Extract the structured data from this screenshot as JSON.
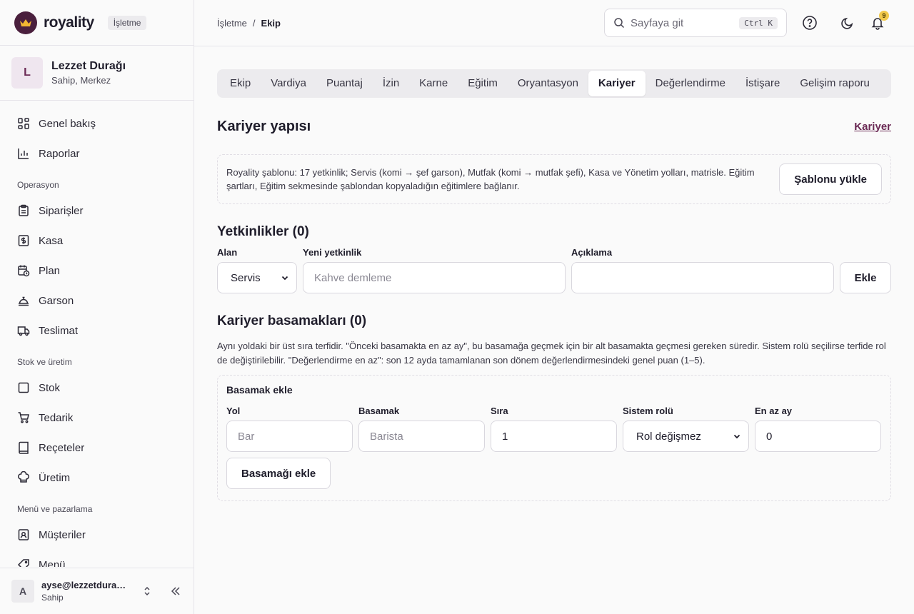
{
  "brand": {
    "name": "royality",
    "badge": "İşletme"
  },
  "org": {
    "initial": "L",
    "name": "Lezzet Durağı",
    "subtitle": "Sahip, Merkez"
  },
  "nav": {
    "overview": "Genel bakış",
    "reports": "Raporlar",
    "section_operations": "Operasyon",
    "orders": "Siparişler",
    "cashier": "Kasa",
    "plan": "Plan",
    "waiter": "Garson",
    "delivery": "Teslimat",
    "section_stock": "Stok ve üretim",
    "stock": "Stok",
    "supply": "Tedarik",
    "recipes": "Reçeteler",
    "production": "Üretim",
    "section_menu": "Menü ve pazarlama",
    "customers": "Müşteriler",
    "menu": "Menü"
  },
  "user": {
    "initial": "A",
    "email": "ayse@lezzetduragi.com",
    "role": "Sahip"
  },
  "header": {
    "crumb_parent": "İşletme",
    "crumb_sep": "/",
    "crumb_current": "Ekip",
    "search_placeholder": "Sayfaya git",
    "search_shortcut": "Ctrl K",
    "notification_count": "9"
  },
  "tabs": [
    "Ekip",
    "Vardiya",
    "Puantaj",
    "İzin",
    "Karne",
    "Eğitim",
    "Oryantasyon",
    "Kariyer",
    "Değerlendirme",
    "İstişare",
    "Gelişim raporu"
  ],
  "active_tab": "Kariyer",
  "page": {
    "title": "Kariyer yapısı",
    "link": "Kariyer",
    "template_text": "Royality şablonu: 17 yetkinlik; Servis (komi → şef garson), Mutfak (komi → mutfak şefi), Kasa ve Yönetim yolları, matrisle. Eğitim şartları, Eğitim sekmesinde şablondan kopyaladığın eğitimlere bağlanır.",
    "template_button": "Şablonu yükle"
  },
  "competencies": {
    "title": "Yetkinlikler (0)",
    "area_label": "Alan",
    "area_value": "Servis",
    "new_label": "Yeni yetkinlik",
    "new_placeholder": "Kahve demleme",
    "desc_label": "Açıklama",
    "desc_value": "",
    "add_button": "Ekle"
  },
  "steps": {
    "title": "Kariyer basamakları (0)",
    "description": "Aynı yoldaki bir üst sıra terfidir. \"Önceki basamakta en az ay\", bu basamağa geçmek için bir alt basamakta geçmesi gereken süredir. Sistem rolü seçilirse terfide rol de değiştirilebilir. \"Değerlendirme en az\": son 12 ayda tamamlanan son dönem değerlendirmesindeki genel puan (1–5).",
    "box_title": "Basamak ekle",
    "path_label": "Yol",
    "path_placeholder": "Bar",
    "step_label": "Basamak",
    "step_placeholder": "Barista",
    "order_label": "Sıra",
    "order_value": "1",
    "role_label": "Sistem rolü",
    "role_value": "Rol değişmez",
    "min_months_label": "En az ay",
    "min_months_value": "0",
    "add_button": "Basamağı ekle"
  }
}
